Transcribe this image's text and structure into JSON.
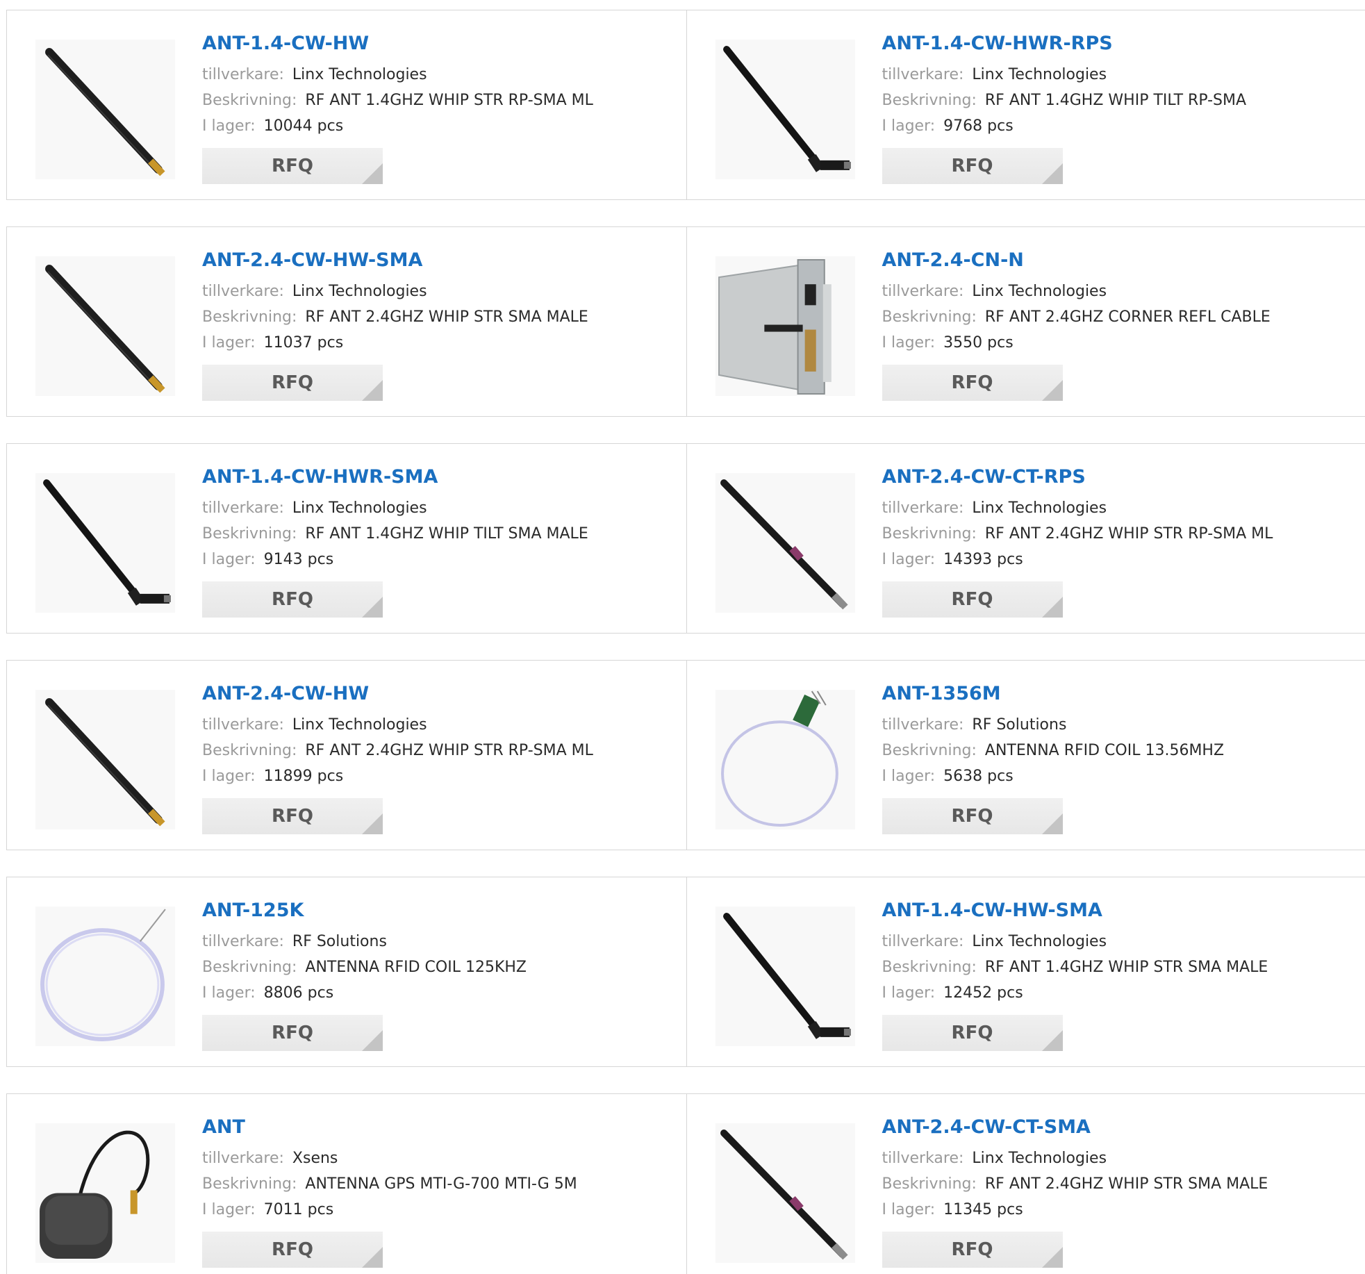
{
  "labels": {
    "manufacturer": "tillverkare:",
    "description": "Beskrivning:",
    "stock": "I lager:",
    "rfq": "RFQ"
  },
  "colors": {
    "title_link": "#1a6fc0",
    "label_text": "#9a9a9a",
    "value_text": "#2a2a2a",
    "button_bg": "#ececec",
    "button_text": "#5a5a5a",
    "border": "#d6d6d6"
  },
  "products": [
    {
      "name": "ANT-1.4-CW-HW",
      "manufacturer": "Linx Technologies",
      "description": "RF ANT 1.4GHZ WHIP STR RP-SMA ML",
      "stock": "10044 pcs",
      "image": "straight-whip-antenna"
    },
    {
      "name": "ANT-1.4-CW-HWR-RPS",
      "manufacturer": "Linx Technologies",
      "description": "RF ANT 1.4GHZ WHIP TILT RP-SMA",
      "stock": "9768 pcs",
      "image": "tilt-whip-antenna"
    },
    {
      "name": "ANT-2.4-CW-HW-SMA",
      "manufacturer": "Linx Technologies",
      "description": "RF ANT 2.4GHZ WHIP STR SMA MALE",
      "stock": "11037 pcs",
      "image": "straight-whip-antenna"
    },
    {
      "name": "ANT-2.4-CN-N",
      "manufacturer": "Linx Technologies",
      "description": "RF ANT 2.4GHZ CORNER REFL CABLE",
      "stock": "3550 pcs",
      "image": "corner-reflector-antenna"
    },
    {
      "name": "ANT-1.4-CW-HWR-SMA",
      "manufacturer": "Linx Technologies",
      "description": "RF ANT 1.4GHZ WHIP TILT SMA MALE",
      "stock": "9143 pcs",
      "image": "tilt-whip-antenna"
    },
    {
      "name": "ANT-2.4-CW-CT-RPS",
      "manufacturer": "Linx Technologies",
      "description": "RF ANT 2.4GHZ WHIP STR RP-SMA ML",
      "stock": "14393 pcs",
      "image": "banded-whip-antenna"
    },
    {
      "name": "ANT-2.4-CW-HW",
      "manufacturer": "Linx Technologies",
      "description": "RF ANT 2.4GHZ WHIP STR RP-SMA ML",
      "stock": "11899 pcs",
      "image": "straight-whip-antenna"
    },
    {
      "name": "ANT-1356M",
      "manufacturer": "RF Solutions",
      "description": "ANTENNA RFID COIL 13.56MHZ",
      "stock": "5638 pcs",
      "image": "rfid-coil-pcb-antenna"
    },
    {
      "name": "ANT-125K",
      "manufacturer": "RF Solutions",
      "description": "ANTENNA RFID COIL 125KHZ",
      "stock": "8806 pcs",
      "image": "rfid-coil-antenna"
    },
    {
      "name": "ANT-1.4-CW-HW-SMA",
      "manufacturer": "Linx Technologies",
      "description": "RF ANT 1.4GHZ WHIP STR SMA MALE",
      "stock": "12452 pcs",
      "image": "tilt-whip-antenna"
    },
    {
      "name": "ANT",
      "manufacturer": "Xsens",
      "description": "ANTENNA GPS MTI-G-700 MTI-G 5M",
      "stock": "7011 pcs",
      "image": "gps-puck-antenna"
    },
    {
      "name": "ANT-2.4-CW-CT-SMA",
      "manufacturer": "Linx Technologies",
      "description": "RF ANT 2.4GHZ WHIP STR SMA MALE",
      "stock": "11345 pcs",
      "image": "banded-whip-antenna"
    }
  ]
}
